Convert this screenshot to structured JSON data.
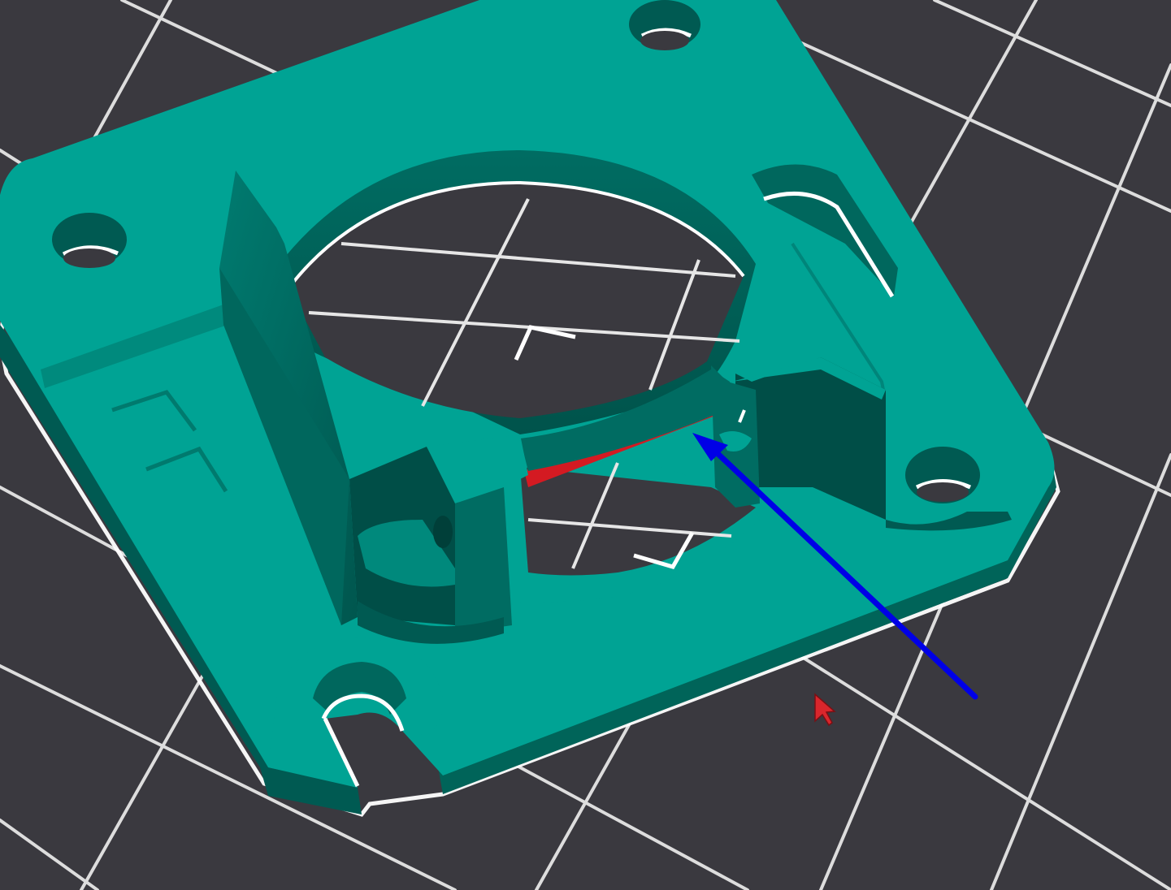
{
  "viewport": {
    "background_color": "#3a393f",
    "grid_color": "#e6e6e6"
  },
  "model": {
    "top_color": "#00a394",
    "wall_color": "#00675d",
    "shadow_color": "#004e47",
    "outline_color": "#ffffff"
  },
  "overhang": {
    "highlight_color": "#d41a22"
  },
  "annotation": {
    "arrow_color": "#0000e6"
  },
  "cursor": {
    "color": "#d9262c",
    "icon": "mouse-pointer-icon"
  }
}
